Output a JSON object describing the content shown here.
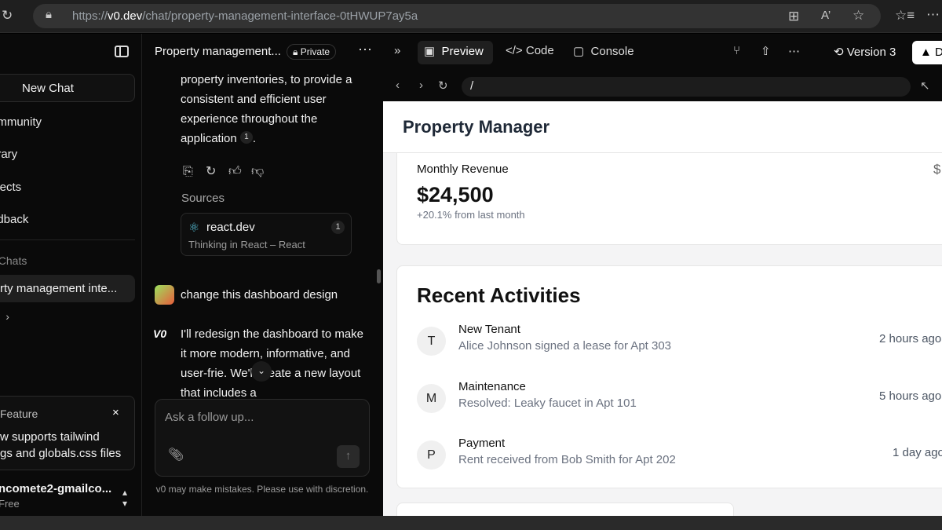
{
  "browser": {
    "url_prefix": "https://",
    "url_host": "v0.dev",
    "url_path": "/chat/property-management-interface-0tHWUP7ay5a"
  },
  "sidebar": {
    "new_chat": "New Chat",
    "items": [
      {
        "label": "ommunity"
      },
      {
        "label": "brary"
      },
      {
        "label": "ojects"
      },
      {
        "label": "edback"
      }
    ],
    "section_label": "t Chats",
    "active_chat": "rty management inte...",
    "view_all": "ll",
    "feature": {
      "title": "Feature",
      "close": "×",
      "text": "w supports tailwind\ngs and globals.css files"
    },
    "account": {
      "name": "ncomete2-gmailco...",
      "plan": "Free"
    }
  },
  "chat": {
    "title": "Property management...",
    "visibility": "Private",
    "message_1": "property inventories, to provide a consistent and efficient user experience throughout the application",
    "message_1_ref": "1",
    "message_1_end": ".",
    "sources_label": "Sources",
    "source": {
      "name": "react.dev",
      "subtitle": "Thinking in React – React",
      "badge": "1"
    },
    "user_message": "change this dashboard design",
    "assistant_logo": "V0",
    "assistant_message_a": "I'll redesign the dashboard to make it more modern, informative, and user-frie",
    "assistant_message_b": ". We'll create a new layout that includes a",
    "input_placeholder": "Ask a follow up...",
    "disclaimer": "v0 may make mistakes. Please use with discretion."
  },
  "topbar": {
    "tabs": [
      {
        "label": "Preview",
        "active": true
      },
      {
        "label": "Code",
        "active": false
      },
      {
        "label": "Console",
        "active": false
      }
    ],
    "version": "Version 3",
    "deploy": "D"
  },
  "preview": {
    "path": "/",
    "app_title": "Property Manager",
    "revenue": {
      "label": "Monthly Revenue",
      "icon": "$",
      "value": "$24,500",
      "change": "+20.1% from last month"
    },
    "recent": {
      "title": "Recent Activities",
      "items": [
        {
          "initial": "T",
          "title": "New Tenant",
          "desc": "Alice Johnson signed a lease for Apt 303",
          "time": "2 hours ago"
        },
        {
          "initial": "M",
          "title": "Maintenance",
          "desc": "Resolved: Leaky faucet in Apt 101",
          "time": "5 hours ago"
        },
        {
          "initial": "P",
          "title": "Payment",
          "desc": "Rent received from Bob Smith for Apt 202",
          "time": "1 day ago"
        }
      ]
    }
  },
  "colors": {
    "accent_react": "#58c4dc",
    "dark_bg": "#0a0a0a",
    "preview_bg": "#f4f4f5"
  }
}
